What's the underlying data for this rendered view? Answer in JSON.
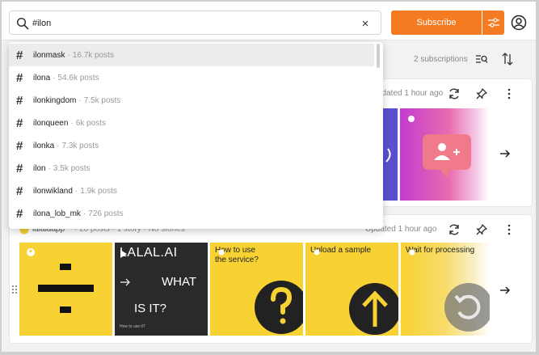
{
  "search": {
    "value": "#ilon",
    "clear_label": "×"
  },
  "header": {
    "subscribe_label": "Subscribe"
  },
  "toolbar": {
    "subscriptions_count": "2 subscriptions"
  },
  "suggestions": [
    {
      "tag": "ilonmask",
      "count": "16.7k posts"
    },
    {
      "tag": "ilona",
      "count": "54.6k posts"
    },
    {
      "tag": "ilonkingdom",
      "count": "7.5k posts"
    },
    {
      "tag": "ilonqueen",
      "count": "6k posts"
    },
    {
      "tag": "ilonka",
      "count": "7.3k posts"
    },
    {
      "tag": "ilon",
      "count": "3.5k posts"
    },
    {
      "tag": "ilonwikland",
      "count": "1.9k posts"
    },
    {
      "tag": "ilona_lob_mk",
      "count": "726 posts"
    }
  ],
  "card1": {
    "updated": "pdated 1 hour ago"
  },
  "card2": {
    "channel": "lalalaapp",
    "meta": "· 20 posts · 1 story · No stories",
    "updated": "Updated 1 hour ago",
    "thumbs": [
      {
        "text": ""
      },
      {
        "text": "LALAL.AI",
        "text2": "WHAT",
        "text3": "IS IT?",
        "text4": "How to use it?"
      },
      {
        "text": "How to use",
        "text2": "the service?"
      },
      {
        "text": "Upload a sample"
      },
      {
        "text": "Wait for processing"
      }
    ]
  },
  "colors": {
    "accent": "#f47b22",
    "yellow": "#f7d232",
    "dark": "#2a2a2a",
    "purple": "#5b4fcf",
    "pink": "#c43bd0"
  }
}
